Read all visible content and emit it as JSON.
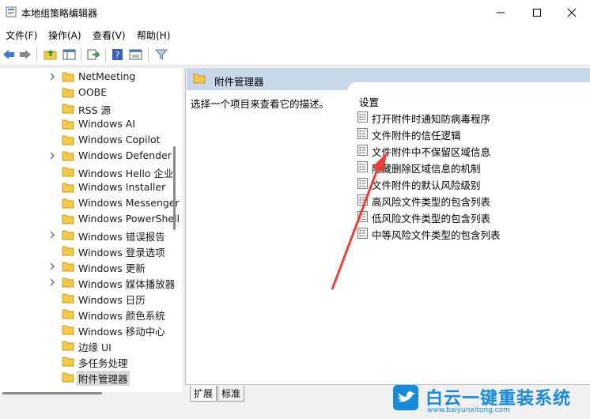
{
  "window": {
    "title": "本地组策略编辑器",
    "icon": "policy-editor-icon",
    "controls": [
      "minimize-icon",
      "maximize-icon",
      "close-icon"
    ]
  },
  "menu": [
    "文件(F)",
    "操作(A)",
    "查看(V)",
    "帮助(H)"
  ],
  "toolbar": [
    "back-arrow-icon",
    "forward-arrow-icon",
    "up-folder-icon",
    "show-hide-tree-icon",
    "export-list-icon",
    "help-icon",
    "properties-icon",
    "filter-icon"
  ],
  "tree": {
    "items": [
      {
        "label": "NetMeeting",
        "expandable": true
      },
      {
        "label": "OOBE",
        "expandable": false
      },
      {
        "label": "RSS 源",
        "expandable": false
      },
      {
        "label": "Windows AI",
        "expandable": false
      },
      {
        "label": "Windows Copilot",
        "expandable": false
      },
      {
        "label": "Windows Defender",
        "expandable": true
      },
      {
        "label": "Windows Hello 企业",
        "expandable": false
      },
      {
        "label": "Windows Installer",
        "expandable": false
      },
      {
        "label": "Windows Messenger",
        "expandable": false
      },
      {
        "label": "Windows PowerShell",
        "expandable": false
      },
      {
        "label": "Windows 错误报告",
        "expandable": true
      },
      {
        "label": "Windows 登录选项",
        "expandable": false
      },
      {
        "label": "Windows 更新",
        "expandable": true
      },
      {
        "label": "Windows 媒体播放器",
        "expandable": true
      },
      {
        "label": "Windows 日历",
        "expandable": false
      },
      {
        "label": "Windows 颜色系统",
        "expandable": false
      },
      {
        "label": "Windows 移动中心",
        "expandable": false
      },
      {
        "label": "边缘 UI",
        "expandable": false
      },
      {
        "label": "多任务处理",
        "expandable": false
      },
      {
        "label": "附件管理器",
        "expandable": false,
        "selected": true
      }
    ]
  },
  "right": {
    "header_title": "附件管理器",
    "description": "选择一个项目来查看它的描述。",
    "settings_header": "设置",
    "settings": [
      "打开附件时通知防病毒程序",
      "文件附件的信任逻辑",
      "文件附件中不保留区域信息",
      "隐藏删除区域信息的机制",
      "文件附件的默认风险级别",
      "高风险文件类型的包含列表",
      "低风险文件类型的包含列表",
      "中等风险文件类型的包含列表"
    ]
  },
  "tabs": [
    "扩展",
    "标准"
  ],
  "watermark": {
    "title": "白云一键重装系统",
    "url": "www.baiyunxitong.com",
    "color": "#1a8ad8"
  },
  "colors": {
    "header_bg": "#c9d7ea",
    "arrow": "#e8413b",
    "folder": "#f3c94b"
  }
}
